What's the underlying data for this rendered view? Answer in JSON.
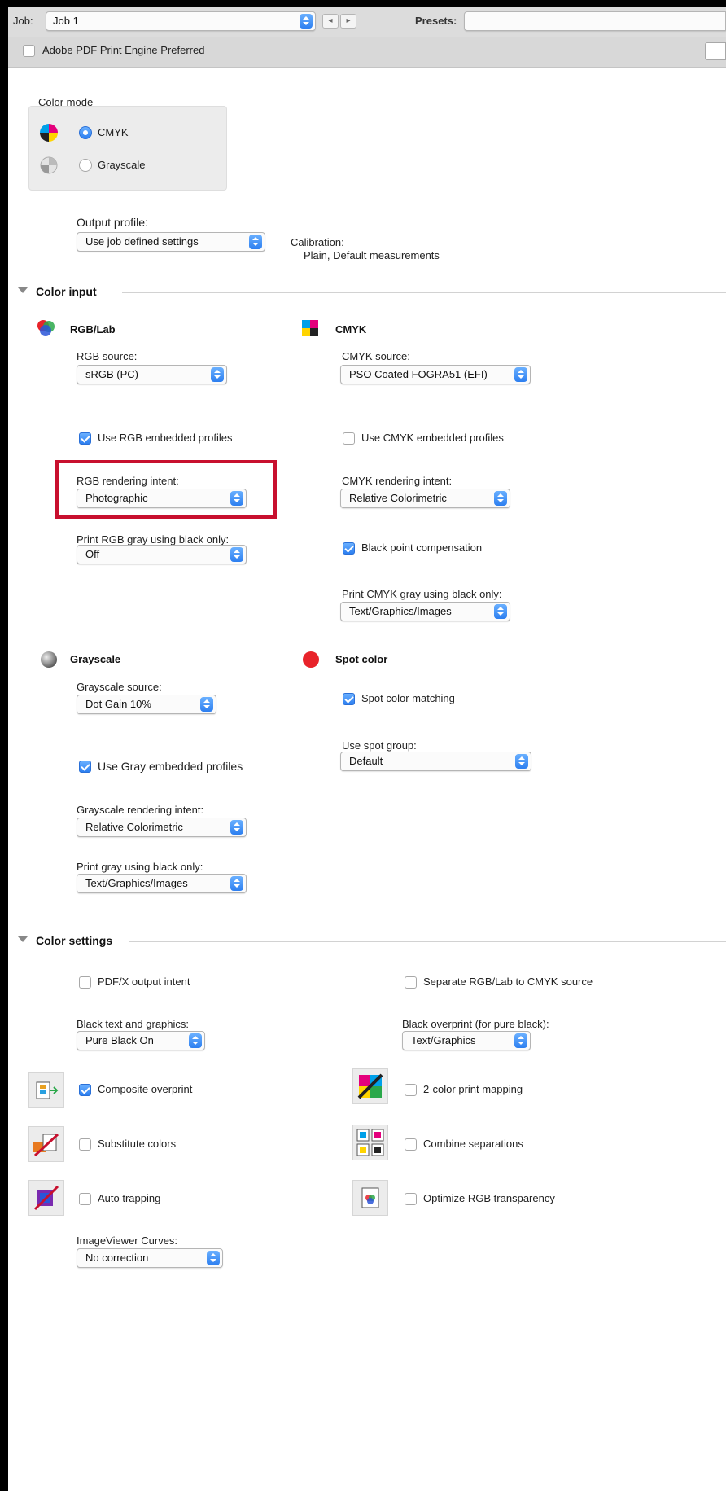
{
  "toolbar": {
    "job_label": "Job:",
    "job_value": "Job 1",
    "presets_label": "Presets:",
    "nav_prev": "◂",
    "nav_next": "▸",
    "pdf_engine_label": "Adobe PDF Print Engine Preferred"
  },
  "color_mode": {
    "title": "Color mode",
    "options": [
      "CMYK",
      "Grayscale"
    ],
    "selected": "CMYK"
  },
  "output": {
    "profile_label": "Output profile:",
    "profile_value": "Use job defined settings",
    "calibration_label": "Calibration:",
    "calibration_value": "Plain, Default measurements"
  },
  "color_input": {
    "section_title": "Color input",
    "rgb": {
      "title": "RGB/Lab",
      "source_label": "RGB source:",
      "source_value": "sRGB (PC)",
      "embedded_label": "Use RGB embedded profiles",
      "embedded_checked": true,
      "intent_label": "RGB rendering intent:",
      "intent_value": "Photographic",
      "gray_black_label": "Print RGB gray using black only:",
      "gray_black_value": "Off"
    },
    "cmyk": {
      "title": "CMYK",
      "source_label": "CMYK source:",
      "source_value": "PSO Coated FOGRA51 (EFI)",
      "embedded_label": "Use CMYK embedded profiles",
      "embedded_checked": false,
      "intent_label": "CMYK rendering intent:",
      "intent_value": "Relative Colorimetric",
      "bpc_label": "Black point compensation",
      "bpc_checked": true,
      "gray_black_label": "Print CMYK gray using black only:",
      "gray_black_value": "Text/Graphics/Images"
    },
    "grayscale": {
      "title": "Grayscale",
      "source_label": "Grayscale source:",
      "source_value": "Dot Gain 10%",
      "embedded_label": "Use Gray embedded profiles",
      "embedded_checked": true,
      "intent_label": "Grayscale rendering intent:",
      "intent_value": "Relative Colorimetric",
      "gray_black_label": "Print gray using black only:",
      "gray_black_value": "Text/Graphics/Images"
    },
    "spot": {
      "title": "Spot color",
      "matching_label": "Spot color matching",
      "matching_checked": true,
      "group_label": "Use spot group:",
      "group_value": "Default"
    }
  },
  "color_settings": {
    "section_title": "Color settings",
    "pdfx_label": "PDF/X output intent",
    "separate_label": "Separate RGB/Lab to CMYK source",
    "black_text_label": "Black text and graphics:",
    "black_text_value": "Pure Black On",
    "black_overprint_label": "Black overprint (for pure black):",
    "black_overprint_value": "Text/Graphics",
    "composite_overprint_label": "Composite overprint",
    "composite_overprint_checked": true,
    "two_color_label": "2-color print mapping",
    "substitute_label": "Substitute colors",
    "combine_label": "Combine separations",
    "auto_trapping_label": "Auto trapping",
    "optimize_rgb_label": "Optimize RGB transparency",
    "curves_label": "ImageViewer Curves:",
    "curves_value": "No correction"
  },
  "colors": {
    "accent": "#2d7ff0",
    "highlight": "#c8102e"
  }
}
